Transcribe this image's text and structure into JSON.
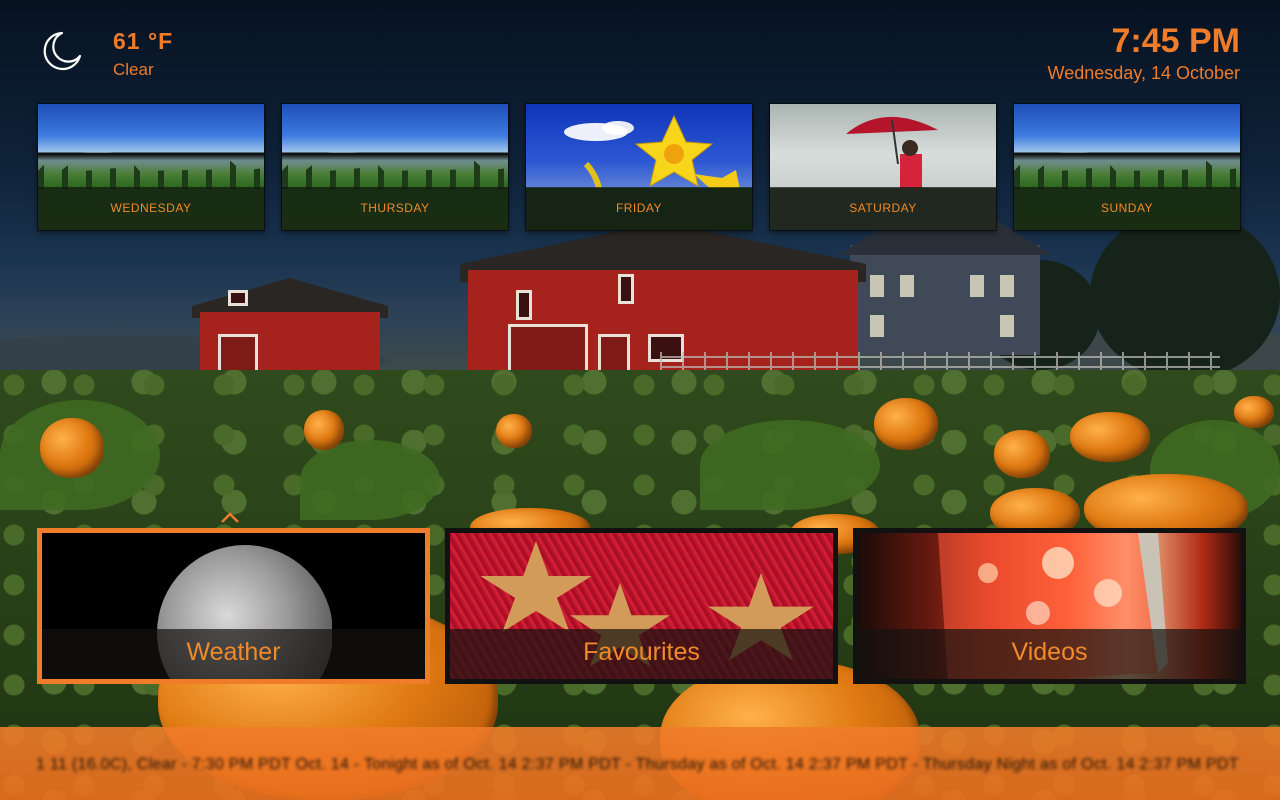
{
  "weather": {
    "temperature": "61 °F",
    "condition": "Clear",
    "icon": "moon-icon"
  },
  "clock": {
    "time": "7:45 PM",
    "date": "Wednesday, 14 October"
  },
  "forecast": [
    {
      "day": "WEDNESDAY",
      "art": "mountain"
    },
    {
      "day": "THURSDAY",
      "art": "mountain"
    },
    {
      "day": "FRIDAY",
      "art": "daffodil"
    },
    {
      "day": "SATURDAY",
      "art": "rain"
    },
    {
      "day": "SUNDAY",
      "art": "mountain"
    }
  ],
  "menu": [
    {
      "label": "Weather",
      "focused": true
    },
    {
      "label": "Favourites",
      "focused": false
    },
    {
      "label": "Videos",
      "focused": false
    }
  ],
  "ticker": {
    "text": "1 11 (16.0C), Clear - 7:30 PM PDT Oct. 14 - Tonight as of Oct. 14 2:37 PM PDT - Thursday as of Oct. 14 2:37 PM PDT - Thursday Night as of Oct. 14 2:37 PM PDT"
  },
  "colors": {
    "accent": "#f07c2a",
    "ticker_bg": "#ee7a22"
  }
}
